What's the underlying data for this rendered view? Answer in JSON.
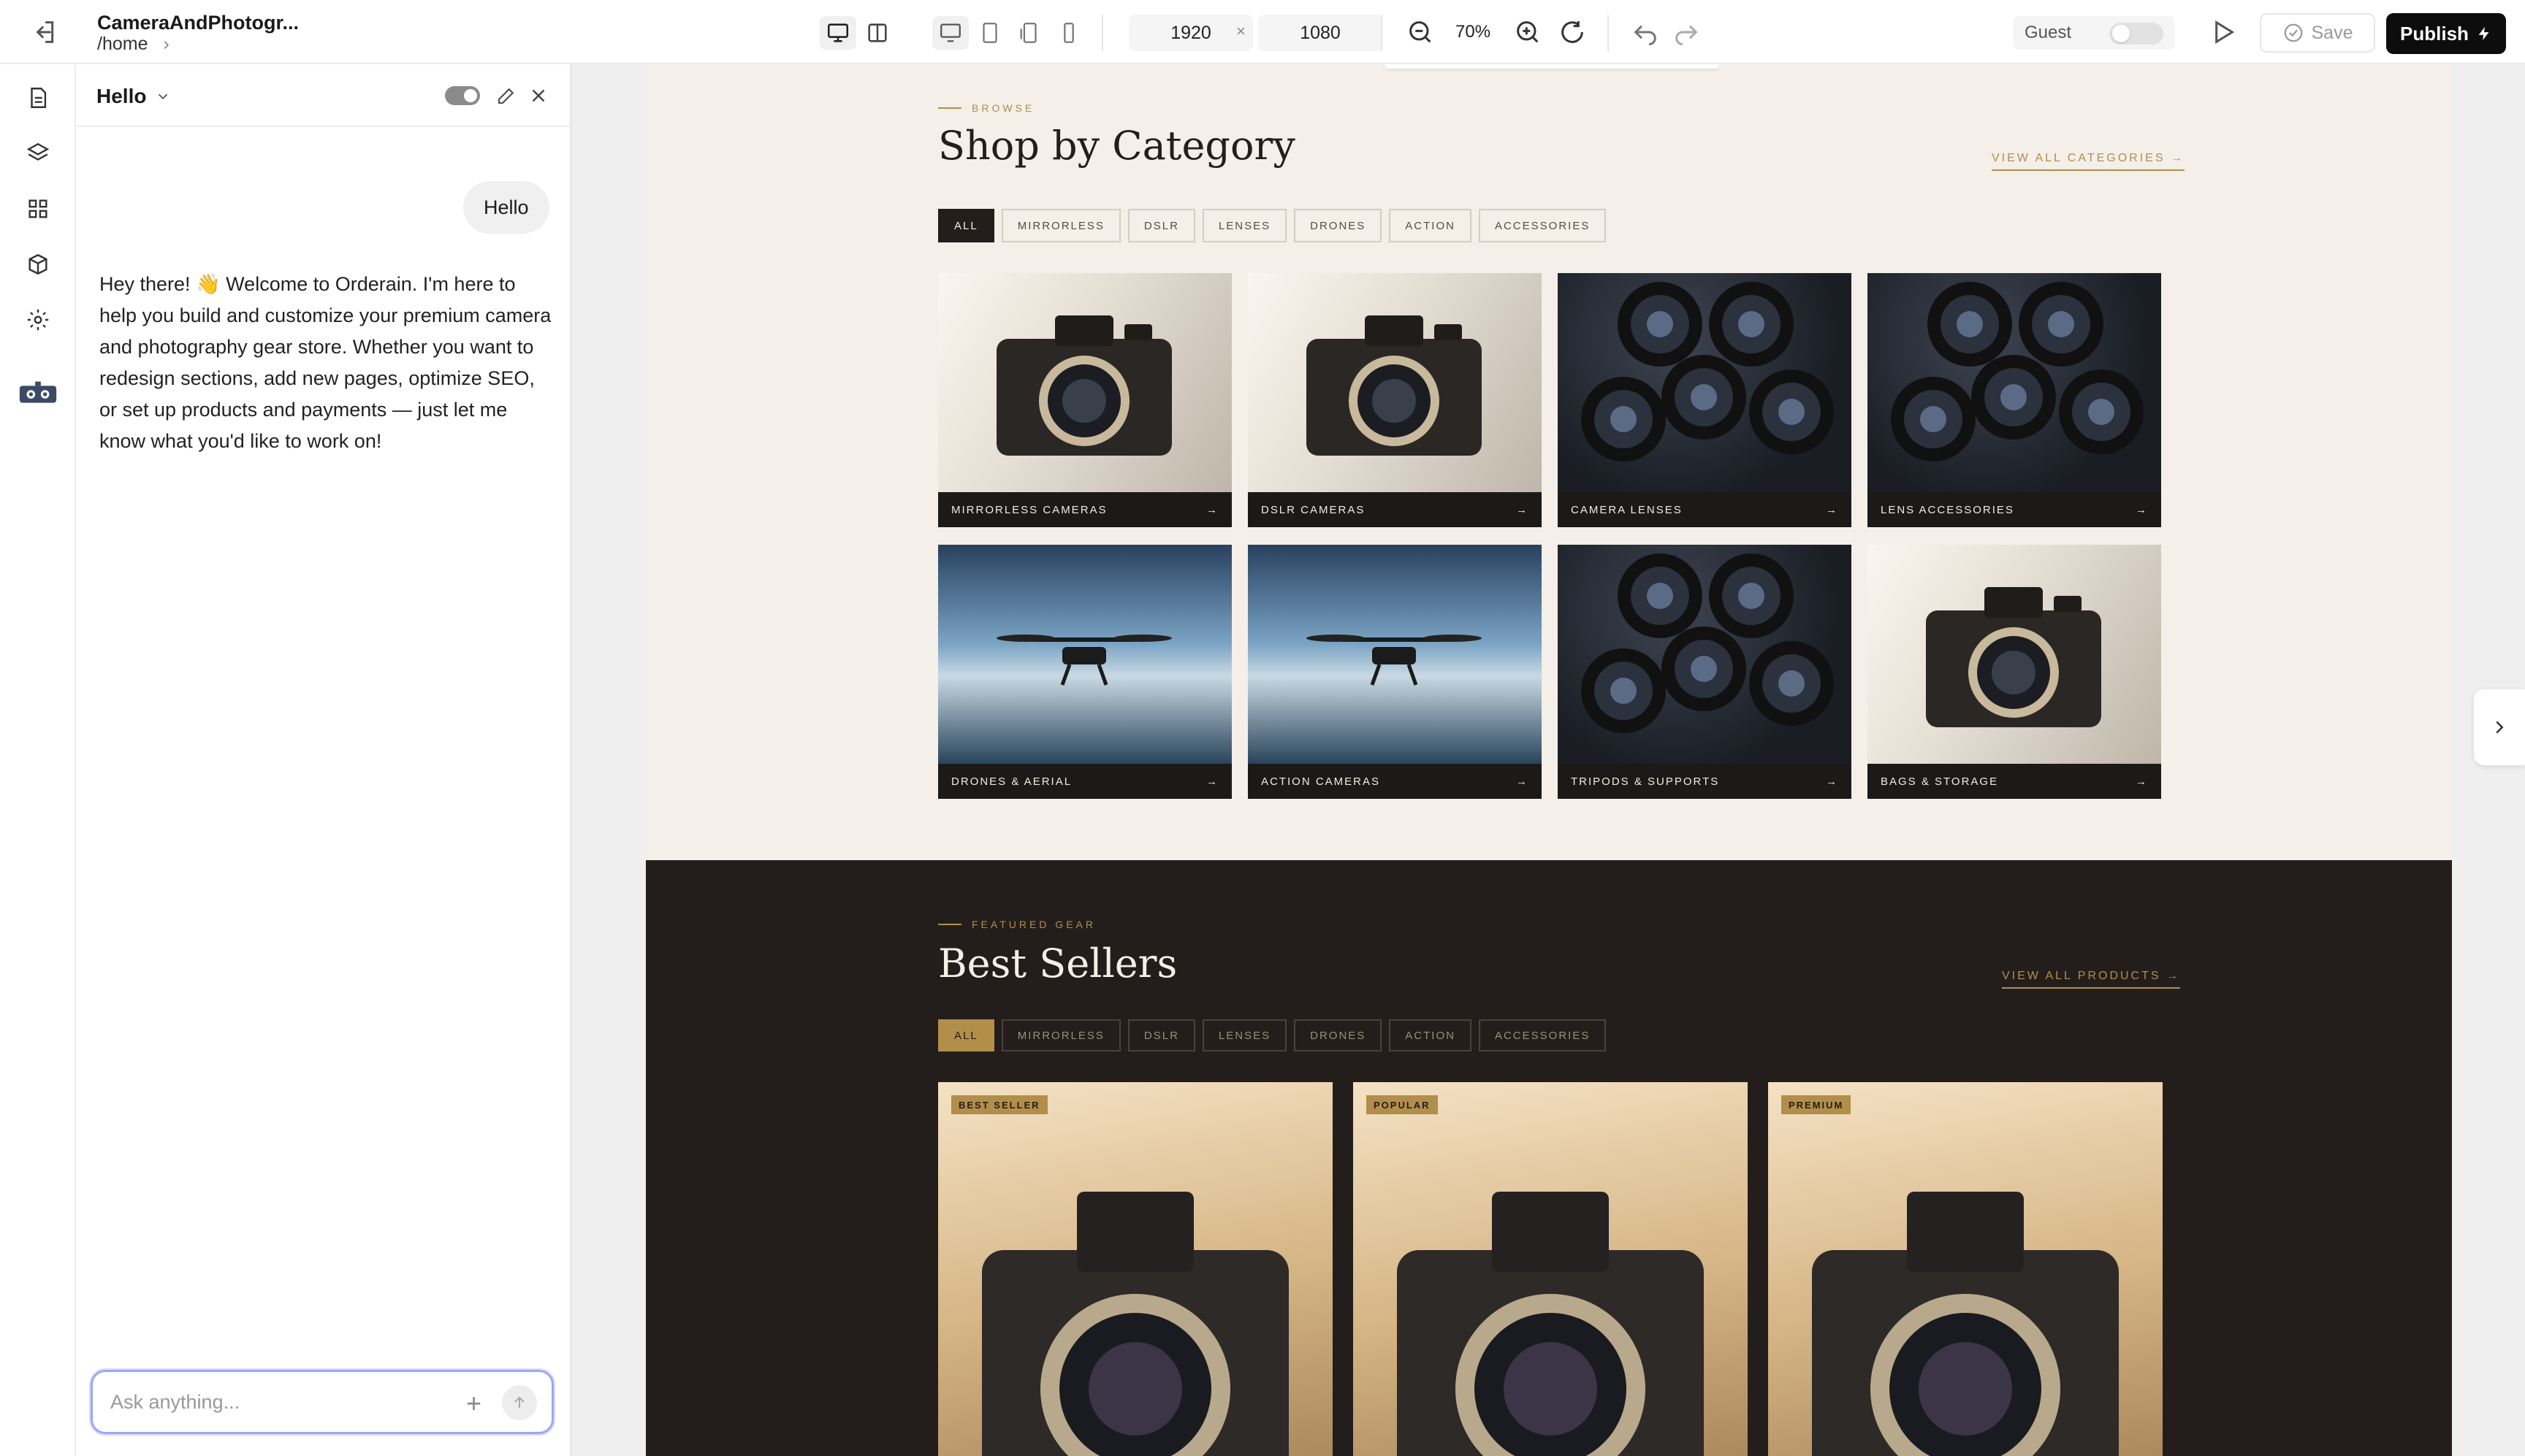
{
  "app": {
    "project_title": "CameraAndPhotogr...",
    "route": "/home"
  },
  "toolbar": {
    "width": "1920",
    "height": "1080",
    "times": "×",
    "zoom": "70%",
    "guest_label": "Guest",
    "save_label": "Save",
    "publish_label": "Publish"
  },
  "chat": {
    "title": "Hello",
    "user_message": "Hello",
    "assistant_message": "Hey there! 👋 Welcome to Orderain. I'm here to help you build and customize your premium camera and photography gear store. Whether you want to redesign sections, add new pages, optimize SEO, or set up products and payments — just let me know what you'd like to work on!",
    "input_placeholder": "Ask anything..."
  },
  "categories": {
    "kicker": "BROWSE",
    "heading": "Shop by Category",
    "view_all": "VIEW ALL CATEGORIES →",
    "filters": [
      "ALL",
      "MIRRORLESS",
      "DSLR",
      "LENSES",
      "DRONES",
      "ACTION",
      "ACCESSORIES"
    ],
    "tiles": [
      {
        "label": "MIRRORLESS CAMERAS",
        "image": "camera"
      },
      {
        "label": "DSLR CAMERAS",
        "image": "camera"
      },
      {
        "label": "CAMERA LENSES",
        "image": "lenses"
      },
      {
        "label": "LENS ACCESSORIES",
        "image": "lenses"
      },
      {
        "label": "DRONES & AERIAL",
        "image": "drone"
      },
      {
        "label": "ACTION CAMERAS",
        "image": "drone"
      },
      {
        "label": "TRIPODS & SUPPORTS",
        "image": "lenses"
      },
      {
        "label": "BAGS & STORAGE",
        "image": "camera"
      }
    ],
    "arrow": "→"
  },
  "bestsellers": {
    "kicker": "FEATURED GEAR",
    "heading": "Best Sellers",
    "view_all": "VIEW ALL PRODUCTS →",
    "filters": [
      "ALL",
      "MIRRORLESS",
      "DSLR",
      "LENSES",
      "DRONES",
      "ACTION",
      "ACCESSORIES"
    ],
    "products": [
      {
        "badge": "BEST SELLER"
      },
      {
        "badge": "POPULAR"
      },
      {
        "badge": "PREMIUM"
      }
    ]
  },
  "colors": {
    "accent": "#b38e4a",
    "dark": "#231e1b",
    "cream": "#f4efe8",
    "publish": "#0d0d0d"
  }
}
